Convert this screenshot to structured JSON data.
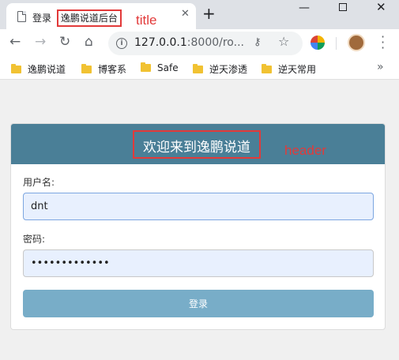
{
  "browser": {
    "tab": {
      "title_prefix": "登录",
      "title_highlight": "逸鹏说道后台"
    },
    "annotation_title": "title",
    "new_tab": "+",
    "window": {
      "minimize": "—",
      "close": "✕"
    }
  },
  "toolbar": {
    "url_host": "127.0.0.1",
    "url_rest": ":8000/ro...",
    "back": "←",
    "forward": "→",
    "reload": "↻",
    "home": "⌂"
  },
  "bookmarks": {
    "items": [
      {
        "label": "逸鹏说道"
      },
      {
        "label": "博客系"
      },
      {
        "label": "Safe"
      },
      {
        "label": "逆天渗透"
      },
      {
        "label": "逆天常用"
      }
    ],
    "more": "»"
  },
  "page": {
    "header_title": "欢迎来到逸鹏说道",
    "annotation_header": "header",
    "username_label": "用户名:",
    "username_value": "dnt",
    "password_label": "密码:",
    "password_value": "•••••••••••••",
    "login_label": "登录"
  }
}
